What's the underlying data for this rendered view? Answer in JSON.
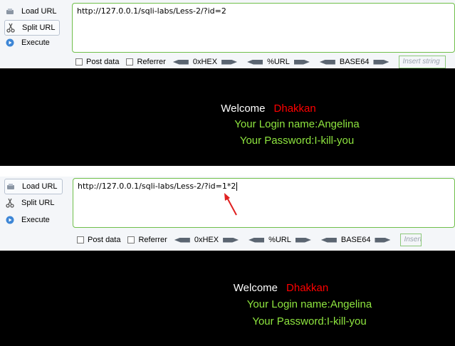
{
  "panels": [
    {
      "menu": {
        "load_url": "Load URL",
        "split_url": "Split URL",
        "execute": "Execute"
      },
      "url": "http://127.0.0.1/sqli-labs/Less-2/?id=2",
      "options": {
        "post_data": "Post data",
        "referrer": "Referrer",
        "hex": "0xHEX",
        "url_enc": "%URL",
        "base64": "BASE64",
        "insert_placeholder": "Insert string"
      },
      "page": {
        "welcome": "Welcome",
        "user": "Dhakkan",
        "login_line": "Your Login name:Angelina",
        "password_line": "Your Password:I-kill-you"
      }
    },
    {
      "menu": {
        "load_url": "Load URL",
        "split_url": "Split URL",
        "execute": "Execute"
      },
      "url": "http://127.0.0.1/sqli-labs/Less-2/?id=1*2",
      "options": {
        "post_data": "Post data",
        "referrer": "Referrer",
        "hex": "0xHEX",
        "url_enc": "%URL",
        "base64": "BASE64",
        "insert_placeholder": "Insert"
      },
      "page": {
        "welcome": "Welcome",
        "user": "Dhakkan",
        "login_line": "Your Login name:Angelina",
        "password_line": "Your Password:I-kill-you"
      }
    }
  ],
  "colors": {
    "page_bg": "#000000",
    "welcome": "#ffffff",
    "username": "#ff0000",
    "info_text": "#8ee53f",
    "url_border": "#6fbf4a",
    "annotation_arrow": "#e02020"
  }
}
